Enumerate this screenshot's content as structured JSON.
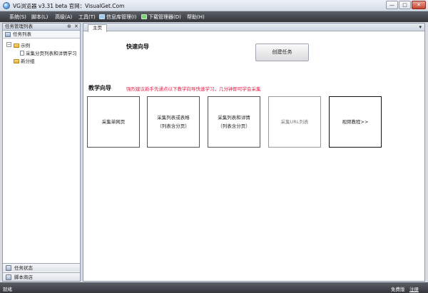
{
  "window": {
    "title": "VG浏览器 v3.31 beta 官网：VisualGet.Com",
    "min_label": "—",
    "max_label": "□",
    "close_label": "✕"
  },
  "menu": {
    "items": [
      {
        "label": "系统(S)",
        "icon": ""
      },
      {
        "label": "脚本(L)",
        "icon": ""
      },
      {
        "label": "高级(A)",
        "icon": ""
      },
      {
        "label": "工具(T)",
        "icon": ""
      },
      {
        "label": "信息库管理(I)",
        "icon": "database-icon"
      },
      {
        "label": "下载管理器(D)",
        "icon": "download-icon"
      },
      {
        "label": "帮助(H)",
        "icon": ""
      }
    ]
  },
  "sidebar": {
    "header": "任务管理列表",
    "pin": "⊕",
    "close": "✕",
    "tab": "任务列表",
    "tree": {
      "root_label": "示例",
      "child_label": "采集分页列表和详情学习",
      "group_label": "新分组",
      "expander": "−"
    },
    "bottom": {
      "task_status": "任务状态",
      "script_store": "脚本商店"
    }
  },
  "main": {
    "tab_home": "主页",
    "tab_dropdown": "▾",
    "quick_title": "快速向导",
    "create_button": "创建任务",
    "teach_title": "教学向导",
    "hint": "强烈建议新手先通点以下教学向导快速学习，几分钟即可学会采集",
    "cards": [
      {
        "line1": "采集单网页",
        "line2": ""
      },
      {
        "line1": "采集列表或表格",
        "line2": "（列表含分页）"
      },
      {
        "line1": "采集列表和详情",
        "line2": "（列表含分页）"
      },
      {
        "line1": "采集URL列表",
        "line2": ""
      },
      {
        "line1": "视频教程>>",
        "line2": ""
      }
    ]
  },
  "status": {
    "left": "就绪",
    "free": "免费版",
    "register": "注册"
  },
  "colors": {
    "menubar": "#3f4348",
    "hint": "#e0224a"
  }
}
